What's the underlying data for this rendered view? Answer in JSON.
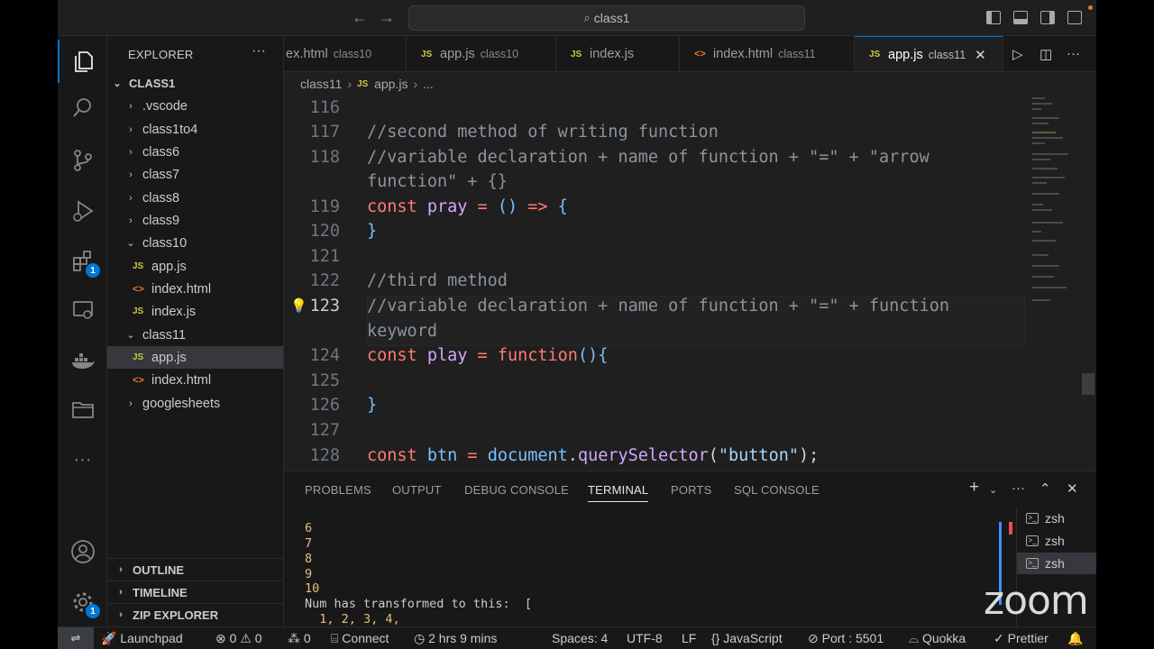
{
  "title_bar": {
    "command_center": "class1",
    "back": "←",
    "forward": "→"
  },
  "activity_bar": {
    "extensions_badge": "1",
    "accounts_badge": "1"
  },
  "sidebar": {
    "header": "EXPLORER",
    "more": "···",
    "root": "CLASS1",
    "items": [
      {
        "label": ".vscode",
        "kind": "folder",
        "expanded": false
      },
      {
        "label": "class1to4",
        "kind": "folder",
        "expanded": false
      },
      {
        "label": "class6",
        "kind": "folder",
        "expanded": false
      },
      {
        "label": "class7",
        "kind": "folder",
        "expanded": false
      },
      {
        "label": "class8",
        "kind": "folder",
        "expanded": false
      },
      {
        "label": "class9",
        "kind": "folder",
        "expanded": false
      },
      {
        "label": "class10",
        "kind": "folder",
        "expanded": true
      },
      {
        "label": "app.js",
        "kind": "js"
      },
      {
        "label": "index.html",
        "kind": "html"
      },
      {
        "label": "index.js",
        "kind": "js"
      },
      {
        "label": "class11",
        "kind": "folder",
        "expanded": true
      },
      {
        "label": "app.js",
        "kind": "js",
        "selected": true
      },
      {
        "label": "index.html",
        "kind": "html"
      },
      {
        "label": "googlesheets",
        "kind": "folder",
        "expanded": false
      }
    ],
    "sections": [
      "OUTLINE",
      "TIMELINE",
      "ZIP EXPLORER"
    ]
  },
  "tabs": [
    {
      "label": "ex.html",
      "desc": "class10",
      "icon": "html-file-icon"
    },
    {
      "label": "app.js",
      "desc": "class10",
      "icon": "js-file-icon"
    },
    {
      "label": "index.js",
      "desc": "",
      "icon": "js-file-icon"
    },
    {
      "label": "index.html",
      "desc": "class11",
      "icon": "html-file-icon"
    },
    {
      "label": "app.js",
      "desc": "class11",
      "icon": "js-file-icon",
      "active": true
    }
  ],
  "breadcrumb": {
    "folder": "class11",
    "file": "app.js",
    "rest": "..."
  },
  "editor": {
    "lines": [
      {
        "n": "116",
        "code": ""
      },
      {
        "n": "117",
        "code": "//second method of writing function"
      },
      {
        "n": "118",
        "code": "//variable declaration + name of function + \"=\" + \"arrow"
      },
      {
        "n": "",
        "code": "function\" + {}"
      },
      {
        "n": "119",
        "code": "const pray = () => {"
      },
      {
        "n": "120",
        "code": "}"
      },
      {
        "n": "121",
        "code": ""
      },
      {
        "n": "122",
        "code": "//third method"
      },
      {
        "n": "123",
        "code": "//variable declaration + name of function + \"=\" + function"
      },
      {
        "n": "",
        "code": "keyword"
      },
      {
        "n": "124",
        "code": "const play = function(){"
      },
      {
        "n": "125",
        "code": ""
      },
      {
        "n": "126",
        "code": "}"
      },
      {
        "n": "127",
        "code": ""
      },
      {
        "n": "128",
        "code": "const btn = document.querySelector(\"button\");"
      }
    ]
  },
  "panel": {
    "tabs": [
      "PROBLEMS",
      "OUTPUT",
      "DEBUG CONSOLE",
      "TERMINAL",
      "PORTS",
      "SQL CONSOLE"
    ],
    "active_tab": "TERMINAL",
    "terminal_lines": [
      "6",
      "7",
      "8",
      "9",
      "10"
    ],
    "terminal_msg": "Num has transformed to this:  [",
    "terminal_arr": "  1, 2, 3, 4,",
    "terminals": [
      "zsh",
      "zsh",
      "zsh"
    ],
    "overlay": "zoom"
  },
  "status_bar": {
    "launchpad": "Launchpad",
    "errors": "0",
    "warnings": "0",
    "ports": "0",
    "connect": "Connect",
    "time": "2 hrs 9 mins",
    "spaces": "Spaces: 4",
    "encoding": "UTF-8",
    "eol": "LF",
    "language": "JavaScript",
    "port": "Port : 5501",
    "quokka": "Quokka",
    "prettier": "Prettier"
  },
  "colors": {
    "accent": "#0078d4",
    "keyword": "#ff7b72",
    "function": "#d2a8ff",
    "variable": "#79c0ff",
    "comment": "#8b949e",
    "number": "#e5c07b"
  }
}
